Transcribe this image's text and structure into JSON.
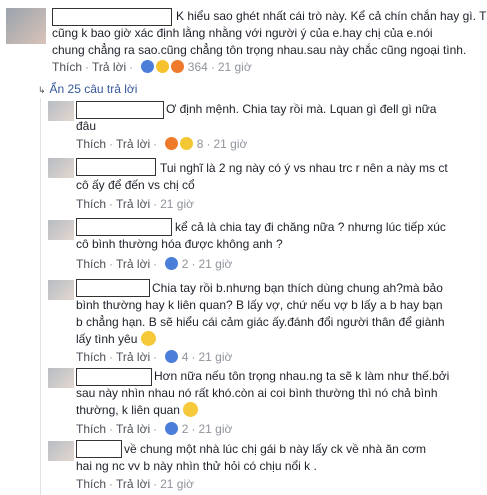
{
  "main_comment": {
    "line1": "K hiểu sao ghét nhất cái trò này. Kể cả chín chắn hay gì. Thì",
    "line2": "cũng k bao giờ xác định lằng nhằng với người ý của e.hay chị của e.nói",
    "line3": "chung chẳng ra sao.cũng chẳng tôn trọng nhau.sau này chắc cũng ngoại tình.",
    "like_label": "Thích",
    "reply_label": "Trả lời",
    "reaction_count": "364",
    "time": "21 giờ"
  },
  "hidden_replies_label": "Ẩn 25 câu trả lời",
  "replies": [
    {
      "lines": [
        "Ơ định mệnh. Chia tay rồi mà. Lquan gì đell gì nữa",
        "đâu"
      ],
      "like_label": "Thích",
      "reply_label": "Trả lời",
      "reaction_count": "8",
      "time": "21 giờ"
    },
    {
      "lines": [
        "Tui nghĩ là 2 ng này có ý vs nhau trc r nên a này ms ct",
        "cô ấy để đến vs chị cổ"
      ],
      "like_label": "Thích",
      "reply_label": "Trả lời",
      "time": "21 giờ"
    },
    {
      "lines": [
        "kể cả là chia tay đi chăng nữa ? nhưng lúc tiếp xúc",
        "cô bình thường hóa được không anh ?"
      ],
      "like_label": "Thích",
      "reply_label": "Trả lời",
      "reaction_count": "2",
      "time": "21 giờ"
    },
    {
      "lines": [
        "Chia tay rồi b.nhưng bạn thích dùng chung ah?mà bảo",
        "bình thường hay k liên quan? B lấy vợ, chứ nếu vợ b lấy a b hay bạn",
        "b chẳng hạn. B sẽ hiểu cái cảm giác ấy.đánh đổi người thân để giành",
        "lấy tình yêu"
      ],
      "like_label": "Thích",
      "reply_label": "Trả lời",
      "reaction_count": "4",
      "time": "21 giờ"
    },
    {
      "lines": [
        "Hơn nữa nếu tôn trọng nhau.ng ta sẽ k làm như thế.bởi",
        "sau này nhìn nhau nó rất khó.còn ai coi bình thường thì nó chả bình",
        "thường, k liên quan"
      ],
      "like_label": "Thích",
      "reply_label": "Trả lời",
      "reaction_count": "2",
      "time": "21 giờ"
    },
    {
      "lines": [
        "về chung một nhà lúc chị gái b này lấy ck về nhà ăn cơm",
        "hai ng nc vv b này nhìn thử hỏi có chịu nổi k ."
      ],
      "like_label": "Thích",
      "reply_label": "Trả lời",
      "time": "21 giờ"
    }
  ],
  "colors": {
    "link": "#365899",
    "meta": "#90949c",
    "text": "#1d2129"
  }
}
